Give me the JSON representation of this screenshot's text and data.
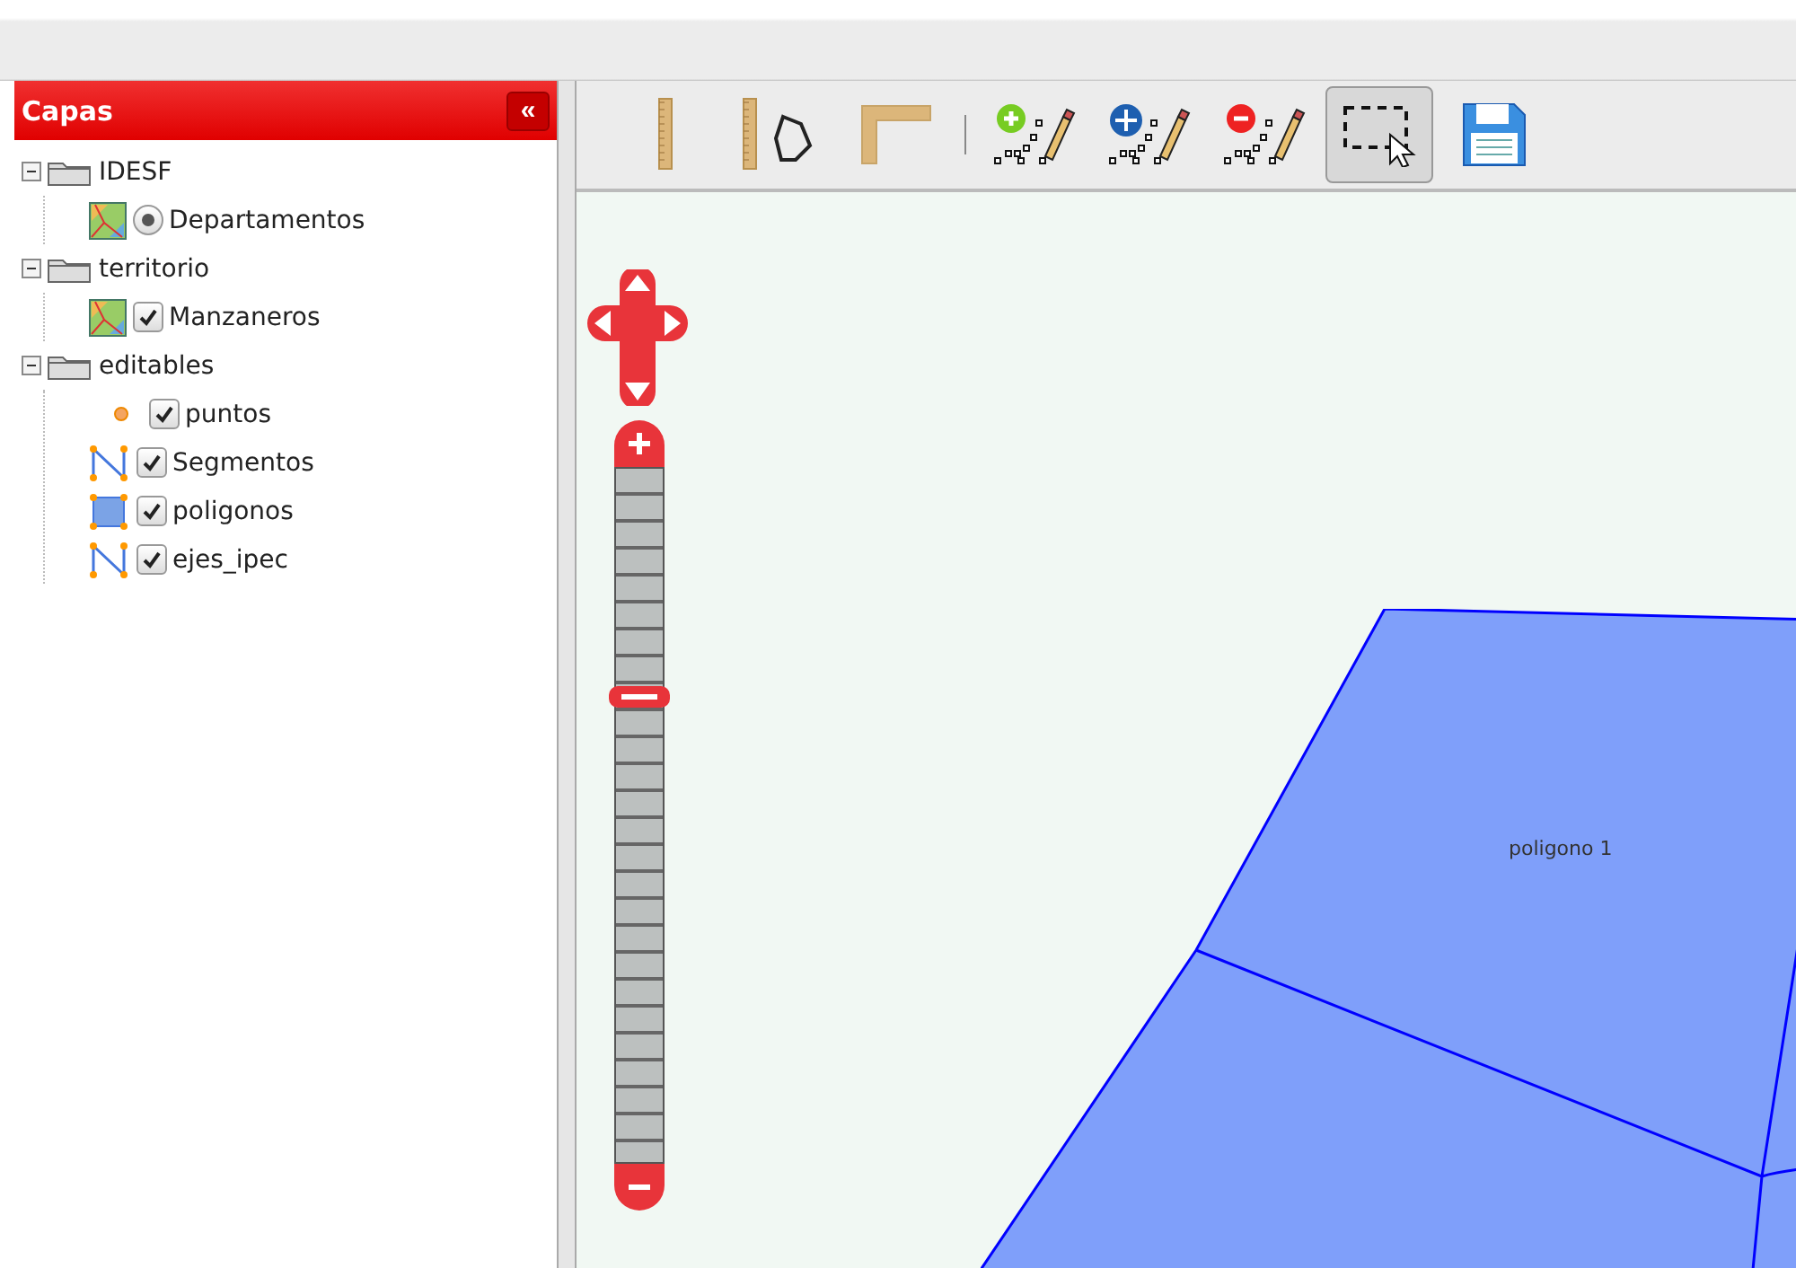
{
  "panel": {
    "title": "Capas",
    "collapse_button": "«"
  },
  "layers": [
    {
      "label": "IDESF",
      "expanded": true,
      "children": [
        {
          "label": "Departamentos",
          "kind": "raster",
          "selected": true
        }
      ]
    },
    {
      "label": "territorio",
      "expanded": true,
      "children": [
        {
          "label": "Manzaneros",
          "kind": "raster",
          "checked": true
        }
      ]
    },
    {
      "label": "editables",
      "expanded": true,
      "children": [
        {
          "label": "puntos",
          "kind": "point",
          "checked": true
        },
        {
          "label": "Segmentos",
          "kind": "line",
          "checked": true
        },
        {
          "label": "poligonos",
          "kind": "polygon",
          "checked": true
        },
        {
          "label": "ejes_ipec",
          "kind": "line",
          "checked": true
        }
      ]
    }
  ],
  "toolbar": [
    {
      "kind": "measure-length",
      "selected": false
    },
    {
      "kind": "measure-area",
      "selected": false
    },
    {
      "kind": "measure-angle",
      "selected": false
    },
    {
      "kind": "separator"
    },
    {
      "kind": "add-feature",
      "selected": false
    },
    {
      "kind": "move-feature",
      "selected": false
    },
    {
      "kind": "delete-feature",
      "selected": false
    },
    {
      "kind": "select-box",
      "selected": true
    },
    {
      "kind": "save",
      "selected": false
    }
  ],
  "map": {
    "zoom": {
      "level": 0.67
    },
    "features": [
      {
        "label": "poligono 1"
      }
    ]
  }
}
